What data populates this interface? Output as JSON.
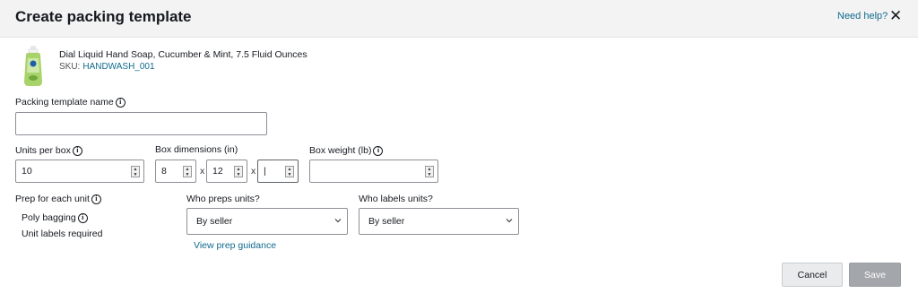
{
  "header": {
    "title": "Create packing template",
    "help_link": "Need help?",
    "close_icon": "close-icon",
    "close_glyph": "✕"
  },
  "product": {
    "name": "Dial Liquid Hand Soap, Cucumber & Mint, 7.5 Fluid Ounces",
    "sku_prefix": "SKU:",
    "sku_value": "HANDWASH_001",
    "image_icon": "product-bottle-image"
  },
  "form": {
    "template_name": {
      "label": "Packing template name",
      "value": ""
    },
    "units_per_box": {
      "label": "Units per box",
      "value": "10"
    },
    "box_dimensions": {
      "label": "Box dimensions (in)",
      "length": "8",
      "width": "12",
      "height": "|",
      "separator": "x"
    },
    "box_weight": {
      "label": "Box weight (lb)",
      "value": ""
    },
    "prep": {
      "label": "Prep for each unit",
      "items": [
        "Poly bagging",
        "Unit labels required"
      ]
    },
    "who_preps": {
      "label": "Who preps units?",
      "value": "By seller"
    },
    "who_labels": {
      "label": "Who labels units?",
      "value": "By seller"
    },
    "prep_guidance_link": "View prep guidance"
  },
  "footer": {
    "cancel_label": "Cancel",
    "save_label": "Save"
  },
  "colors": {
    "link": "#0f6a8e",
    "header_bg": "#f3f3f3",
    "save_disabled": "#a3a7ab"
  }
}
